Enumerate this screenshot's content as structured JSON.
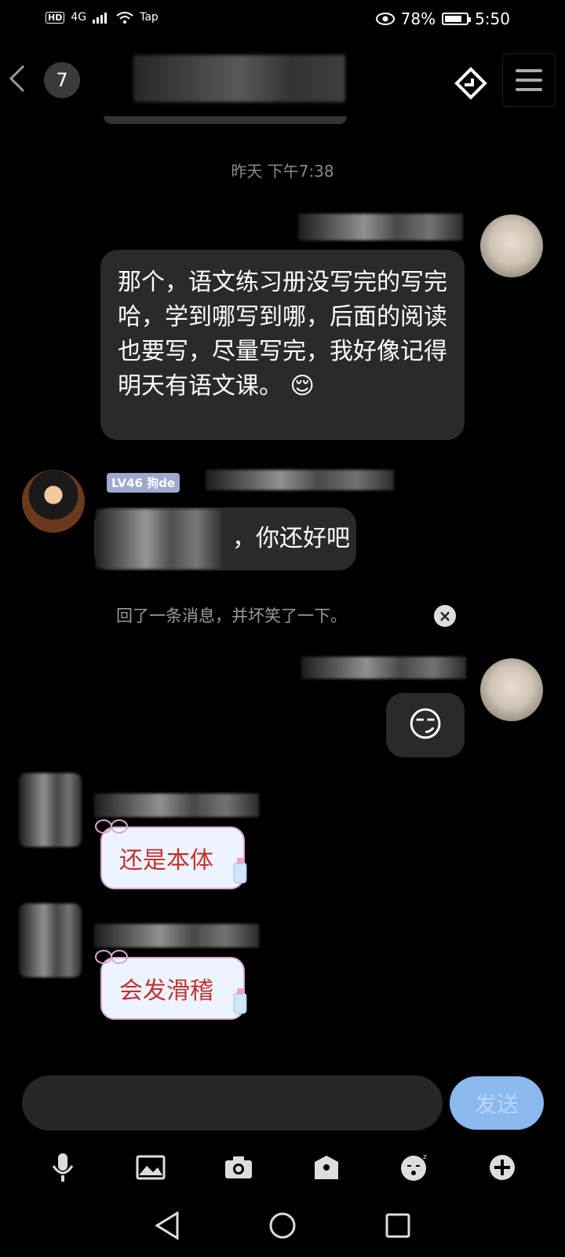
{
  "status_bar": {
    "hd": "HD",
    "network": "4G",
    "tap": "Tap",
    "battery": "78%",
    "time": "5:50"
  },
  "header": {
    "badge_count": "7",
    "icons": {
      "back": "chevron-left-icon",
      "share": "share-icon",
      "menu": "menu-icon"
    }
  },
  "messages": {
    "timestamp": "昨天 下午7:38",
    "msg1": "那个，语文练习册没写完的写完哈，学到哪写到哪，后面的阅读也要写，尽量写完，我好像记得明天有语文课。",
    "msg1_emoji": "😌",
    "level_badge": "LV46 狗de",
    "msg2_tail": "，你还好吧",
    "notice": "回了一条消息，并坏笑了一下。",
    "msg3_emoji": "😏",
    "sticker1": "还是本体",
    "sticker2": "会发滑稽"
  },
  "composer": {
    "send_label": "发送",
    "toolbar_icons": [
      "microphone-icon",
      "image-icon",
      "camera-icon",
      "gift-icon",
      "emoji-icon",
      "plus-icon"
    ]
  },
  "colors": {
    "bubble": "#2a2a2c",
    "send_button": "#8ab9f0",
    "sticker_text": "#c0342f"
  }
}
